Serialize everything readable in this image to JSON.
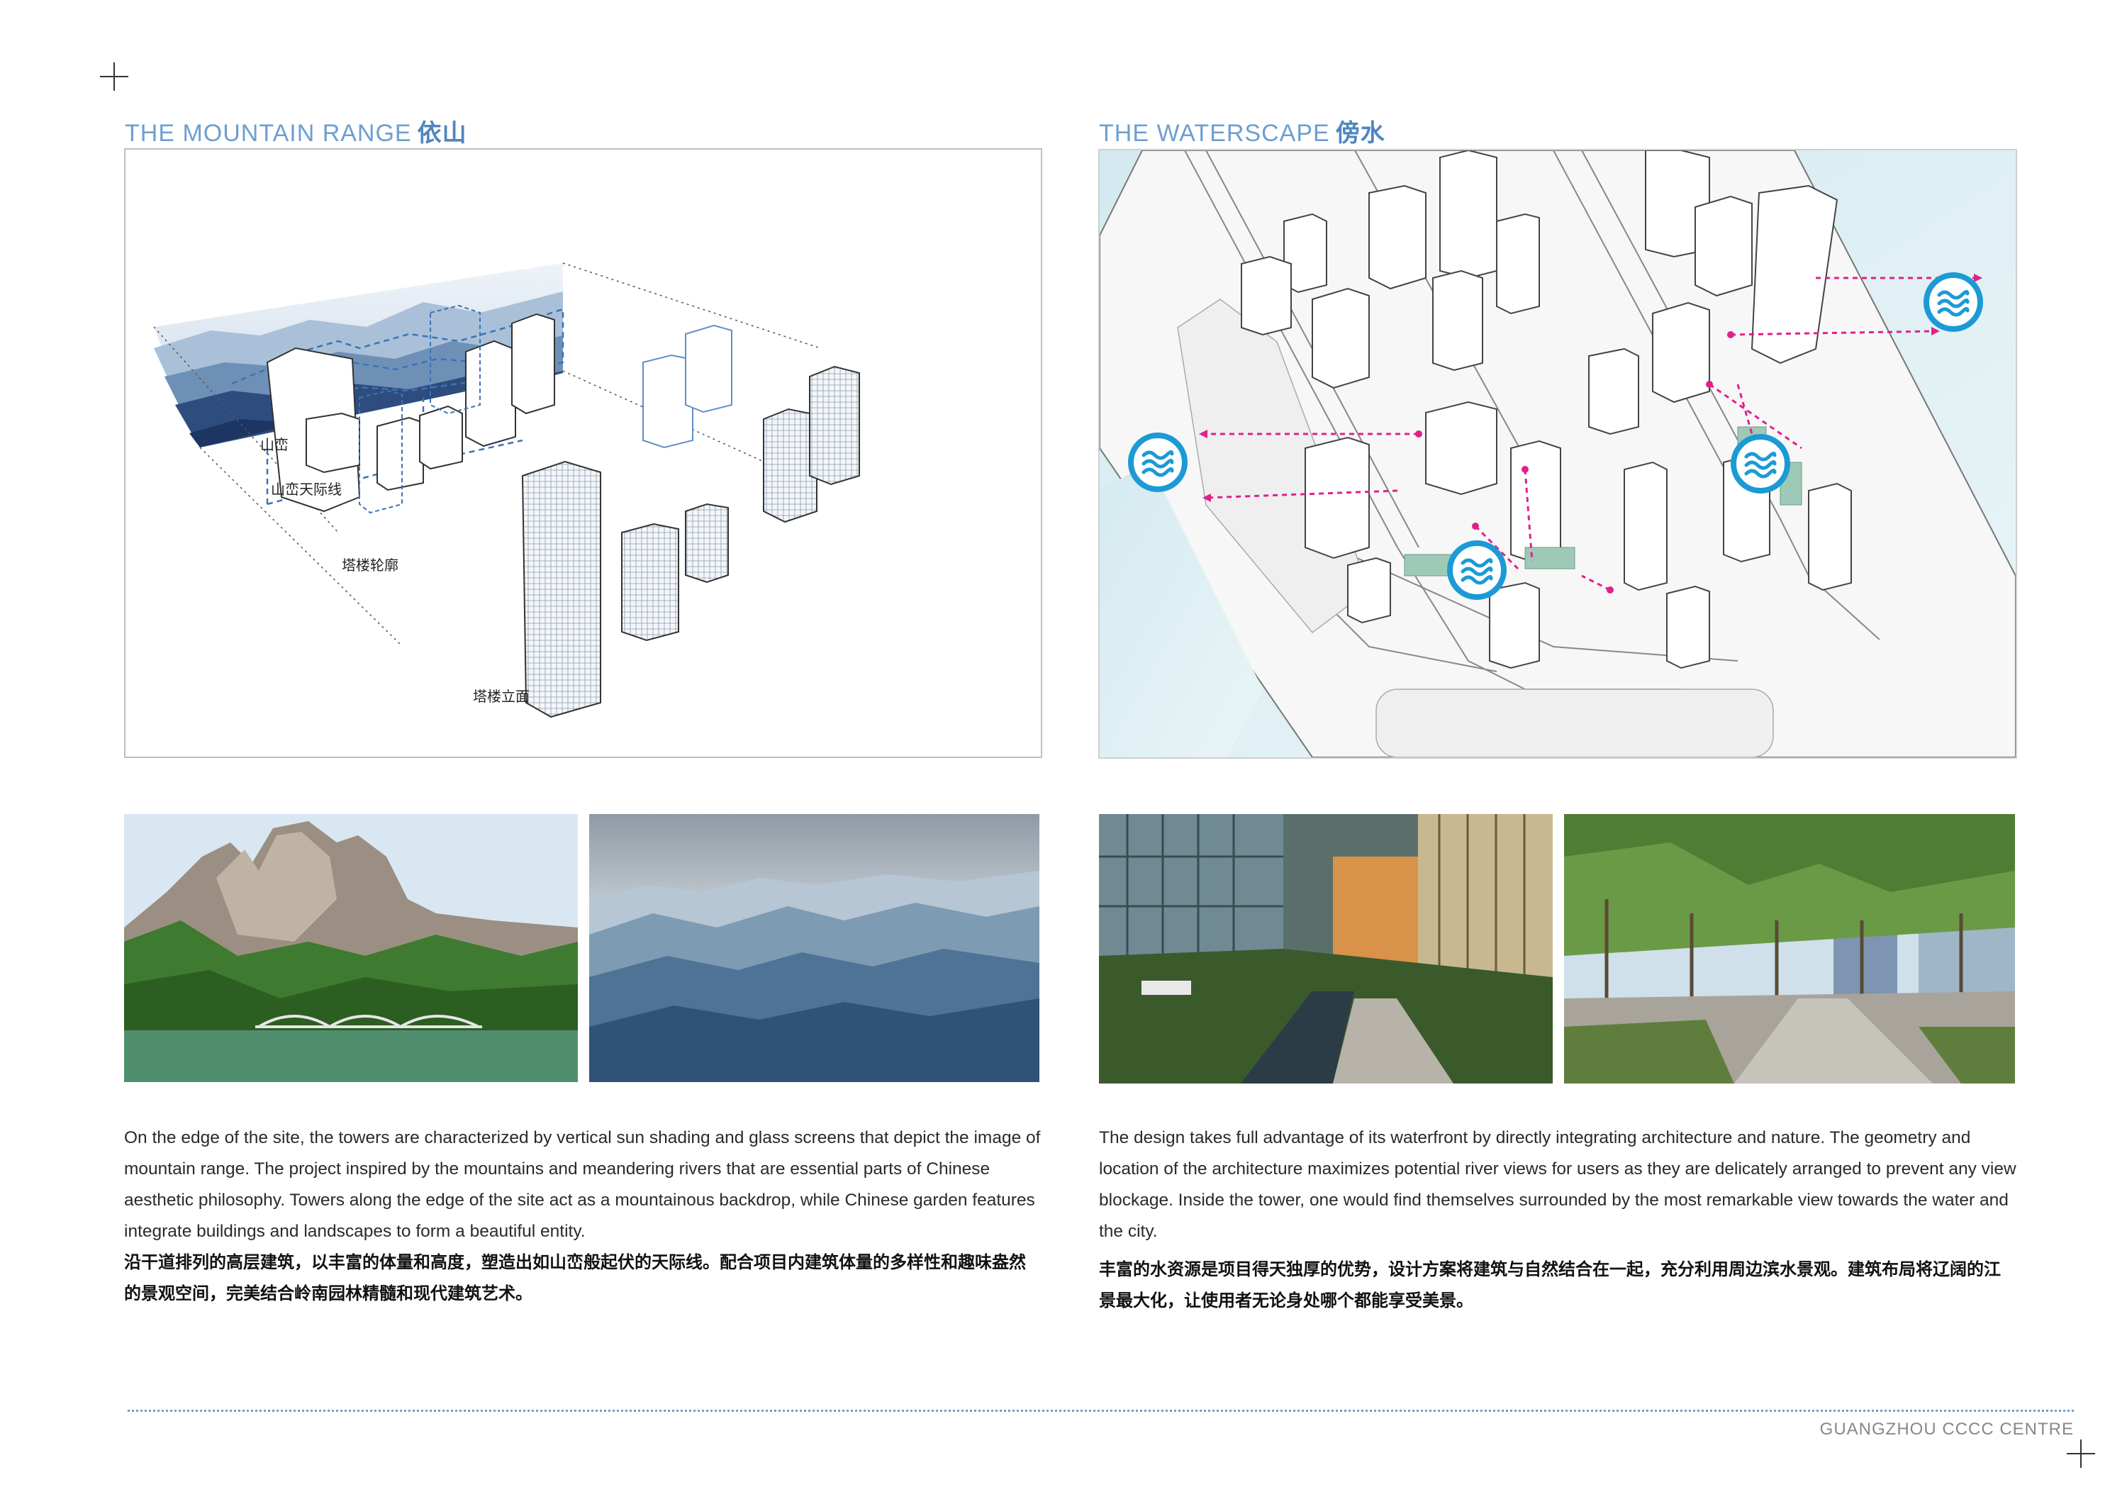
{
  "left": {
    "title_en": "THE MOUNTAIN RANGE",
    "title_cn": "依山",
    "diagram_labels": {
      "shanluan": "山峦",
      "skyline": "山峦天际线",
      "tower_outline": "塔楼轮廓",
      "tower_facade": "塔楼立面"
    },
    "text_en": "On the edge of the site, the towers are characterized by vertical sun shading and glass screens that depict the image of mountain range. The project inspired by the mountains and meandering rivers that are essential parts of Chinese aesthetic philosophy. Towers along the edge of the site act as a mountainous backdrop, while Chinese garden features integrate buildings and landscapes to form a beautiful entity.",
    "text_cn": "沿干道排列的高层建筑，以丰富的体量和高度，塑造出如山峦般起伏的天际线。配合项目内建筑体量的多样性和趣味盎然的景观空间，完美结合岭南园林精髓和现代建筑艺术。"
  },
  "right": {
    "title_en": "THE WATERSCAPE",
    "title_cn": "傍水",
    "text_en": "The design takes full advantage of its waterfront by directly integrating architecture and nature. The geometry and location of the architecture maximizes potential river views for users as they are delicately arranged to prevent any view blockage. Inside the tower, one would find themselves surrounded by the most remarkable view towards the water and the city.",
    "text_cn": "丰富的水资源是项目得天独厚的优势，设计方案将建筑与自然结合在一起，充分利用周边滨水景观。建筑布局将辽阔的江景最大化，让使用者无论身处哪个都能享受美景。"
  },
  "footer": "GUANGZHOU CCCC CENTRE",
  "colors": {
    "accent_blue": "#6d9fcf",
    "water_blue": "#1b9ad6",
    "arrow_magenta": "#e0218a"
  }
}
